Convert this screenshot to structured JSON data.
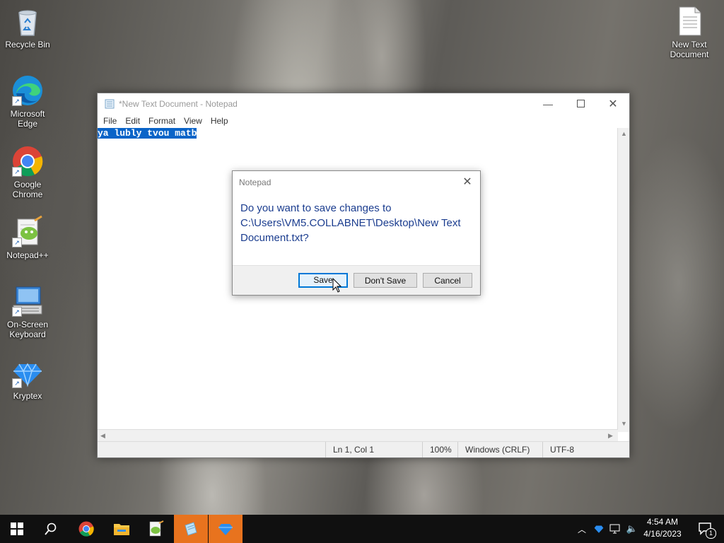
{
  "desktop": {
    "icons": [
      {
        "label": "Recycle Bin",
        "icon": "recycle-bin-icon"
      },
      {
        "label": "Microsoft Edge",
        "icon": "edge-icon"
      },
      {
        "label": "Google Chrome",
        "icon": "chrome-icon"
      },
      {
        "label": "Notepad++",
        "icon": "notepad-plus-plus-icon"
      },
      {
        "label": "On-Screen Keyboard",
        "icon": "keyboard-icon"
      },
      {
        "label": "Kryptex",
        "icon": "kryptex-icon"
      },
      {
        "label": "New Text Document",
        "icon": "text-file-icon"
      }
    ]
  },
  "notepad": {
    "title": "*New Text Document - Notepad",
    "menu": [
      "File",
      "Edit",
      "Format",
      "View",
      "Help"
    ],
    "content": "ya lubly tvou matb",
    "status": {
      "position": "Ln 1, Col 1",
      "zoom": "100%",
      "line_endings": "Windows (CRLF)",
      "encoding": "UTF-8"
    }
  },
  "dialog": {
    "title": "Notepad",
    "message": "Do you want to save changes to C:\\Users\\VM5.COLLABNET\\Desktop\\New Text Document.txt?",
    "buttons": {
      "save": "Save",
      "dont_save": "Don't Save",
      "cancel": "Cancel"
    }
  },
  "taskbar": {
    "pinned": [
      "start-icon",
      "search-icon",
      "chrome-icon",
      "file-explorer-icon",
      "notepad-plus-plus-icon",
      "notepad-icon",
      "kryptex-icon"
    ],
    "clock": {
      "time": "4:54 AM",
      "date": "4/16/2023"
    },
    "notifications_count": "1"
  },
  "colors": {
    "taskbar_active": "#e8731e",
    "selection": "#0a64c8",
    "dialog_text": "#1b3d8f",
    "default_button_border": "#0078d7"
  }
}
